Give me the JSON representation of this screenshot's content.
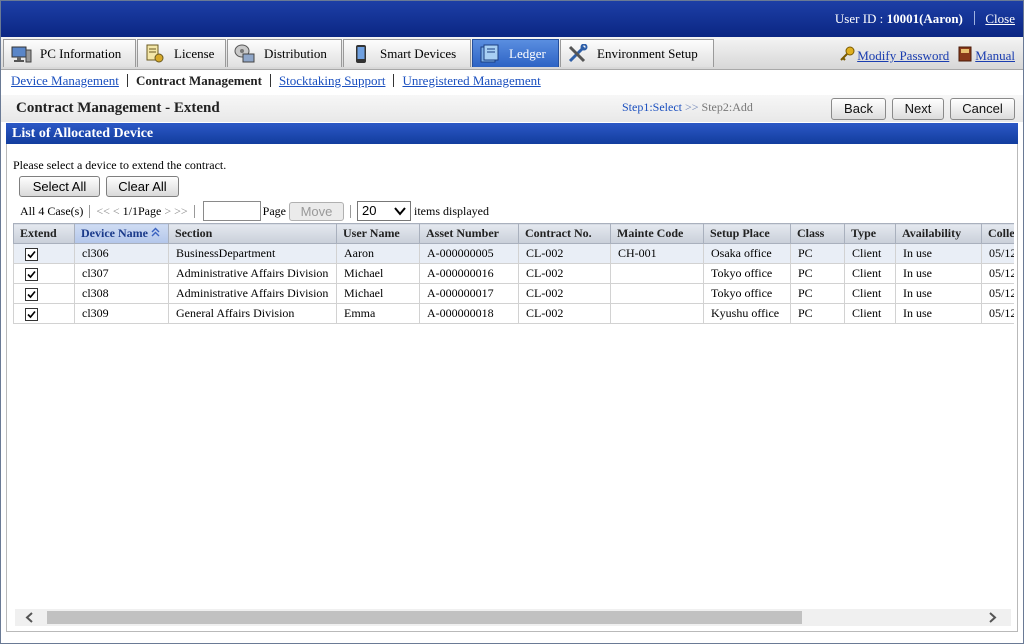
{
  "header": {
    "user_id_label": "User ID :",
    "user_id_value": "10001(Aaron)",
    "close_link": "Close"
  },
  "tabs": [
    {
      "label": "PC Information",
      "icon": "monitor-icon",
      "active": false
    },
    {
      "label": "License",
      "icon": "license-icon",
      "active": false
    },
    {
      "label": "Distribution",
      "icon": "distribution-icon",
      "active": false
    },
    {
      "label": "Smart Devices",
      "icon": "smartphone-icon",
      "active": false
    },
    {
      "label": "Ledger",
      "icon": "ledger-icon",
      "active": true
    },
    {
      "label": "Environment Setup",
      "icon": "tools-icon",
      "active": false
    }
  ],
  "top_links": {
    "modify_password": "Modify Password",
    "manual": "Manual"
  },
  "subnav": {
    "device_management": "Device Management",
    "contract_management": "Contract Management",
    "stocktaking_support": "Stocktaking Support",
    "unregistered_management": "Unregistered Management"
  },
  "page": {
    "title": "Contract Management - Extend",
    "step1": "Step1:Select",
    "step_arrow": ">>",
    "step2": "Step2:Add",
    "back": "Back",
    "next": "Next",
    "cancel": "Cancel"
  },
  "section": {
    "title": "List of Allocated Device",
    "instruction": "Please select a device to extend the contract."
  },
  "buttons": {
    "select_all": "Select All",
    "clear_all": "Clear All"
  },
  "pager": {
    "case_count": "All 4 Case(s)",
    "first": "<<",
    "prev": "<",
    "page_info": "1/1Page",
    "next": ">",
    "last": ">>",
    "page_input_value": "",
    "page_label": "Page",
    "move": "Move",
    "items_per_page": "20",
    "items_label": "items displayed"
  },
  "table": {
    "columns": [
      "Extend",
      "Device Name",
      "Section",
      "User Name",
      "Asset Number",
      "Contract No.",
      "Mainte Code",
      "Setup Place",
      "Class",
      "Type",
      "Availability",
      "Colle"
    ],
    "rows": [
      {
        "extend": true,
        "device": "cl306",
        "section": "BusinessDepartment",
        "user": "Aaron",
        "asset": "A-000000005",
        "contract": "CL-002",
        "mainte": "CH-001",
        "place": "Osaka office",
        "class": "PC",
        "type": "Client",
        "availability": "In use",
        "colle": "05/12"
      },
      {
        "extend": true,
        "device": "cl307",
        "section": "Administrative Affairs Division",
        "user": "Michael",
        "asset": "A-000000016",
        "contract": "CL-002",
        "mainte": "",
        "place": "Tokyo office",
        "class": "PC",
        "type": "Client",
        "availability": "In use",
        "colle": "05/12"
      },
      {
        "extend": true,
        "device": "cl308",
        "section": "Administrative Affairs Division",
        "user": "Michael",
        "asset": "A-000000017",
        "contract": "CL-002",
        "mainte": "",
        "place": "Tokyo office",
        "class": "PC",
        "type": "Client",
        "availability": "In use",
        "colle": "05/12"
      },
      {
        "extend": true,
        "device": "cl309",
        "section": "General Affairs Division",
        "user": "Emma",
        "asset": "A-000000018",
        "contract": "CL-002",
        "mainte": "",
        "place": "Kyushu office",
        "class": "PC",
        "type": "Client",
        "availability": "In use",
        "colle": "05/12"
      }
    ]
  },
  "colors": {
    "header_blue": "#0b2683",
    "active_tab": "#2d63c4",
    "link_blue": "#1a4fbf",
    "section_blue": "#1b47b0",
    "selected_row": "#e9eef6"
  }
}
